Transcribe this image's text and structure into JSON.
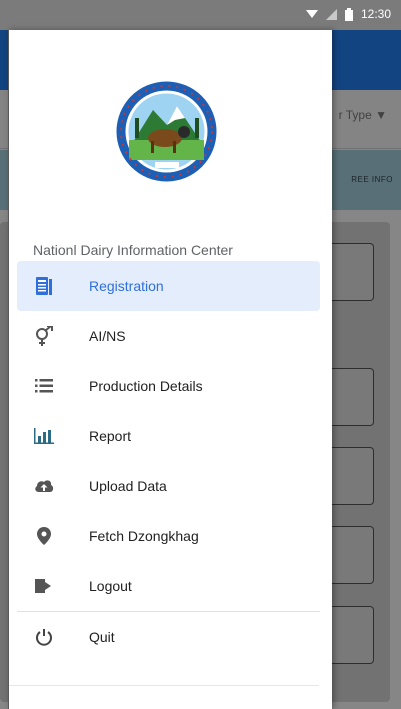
{
  "status": {
    "time": "12:30"
  },
  "background": {
    "dropdown_text": "r Type",
    "tab_text": "REE INFO"
  },
  "drawer": {
    "org_name": "Nationl Dairy Information Center",
    "items": [
      {
        "label": "Registration",
        "icon": "registration-icon",
        "active": true
      },
      {
        "label": "AI/NS",
        "icon": "gender-icon"
      },
      {
        "label": "Production Details",
        "icon": "list-icon"
      },
      {
        "label": "Report",
        "icon": "bar-chart-icon"
      },
      {
        "label": "Upload Data",
        "icon": "cloud-upload-icon"
      },
      {
        "label": "Fetch Dzongkhag",
        "icon": "location-pin-icon"
      },
      {
        "label": "Logout",
        "icon": "logout-icon"
      },
      {
        "label": "Quit",
        "icon": "power-icon"
      }
    ]
  },
  "colors": {
    "accent": "#2f6fdc",
    "active_bg": "#e4edfb",
    "appbar": "#1e6fd0"
  }
}
